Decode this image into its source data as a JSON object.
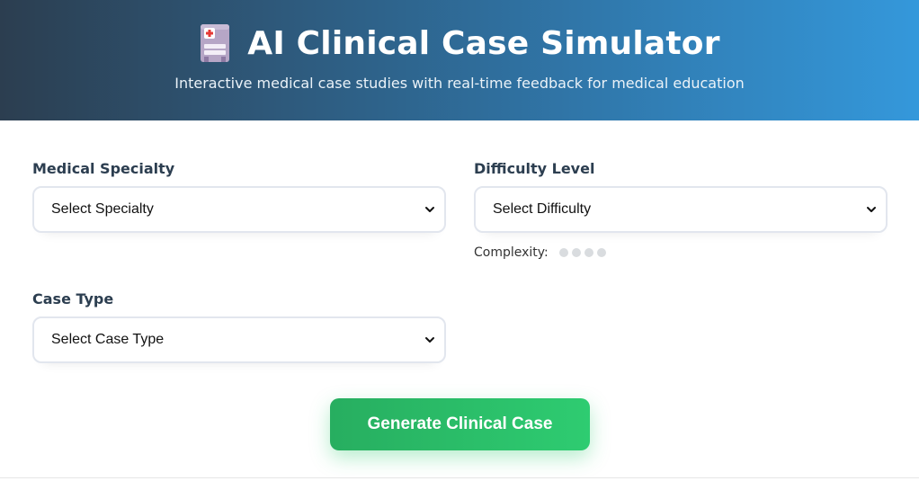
{
  "header": {
    "title": "AI Clinical Case Simulator",
    "subtitle": "Interactive medical case studies with real-time feedback for medical education",
    "icon": "hospital-icon"
  },
  "form": {
    "specialty": {
      "label": "Medical Specialty",
      "selected": "Select Specialty"
    },
    "difficulty": {
      "label": "Difficulty Level",
      "selected": "Select Difficulty",
      "complexity_label": "Complexity:",
      "complexity_level": 0,
      "complexity_max": 4
    },
    "case_type": {
      "label": "Case Type",
      "selected": "Select Case Type"
    },
    "generate_label": "Generate Clinical Case"
  },
  "colors": {
    "header_start": "#2c3e50",
    "header_end": "#3498db",
    "button_start": "#27ae60",
    "button_end": "#2ecc71",
    "label_text": "#2c3e50"
  }
}
